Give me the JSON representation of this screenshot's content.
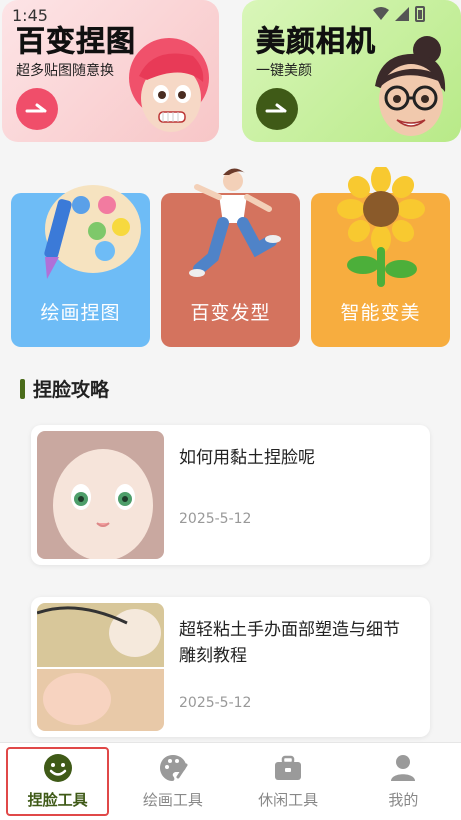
{
  "status_bar": {
    "time": "1:45"
  },
  "banners": [
    {
      "title": "百变捏图",
      "subtitle": "超多贴图随意换",
      "arrow_icon": "arrow-right-icon",
      "accent": "#f04e6a"
    },
    {
      "title": "美颜相机",
      "subtitle": "一键美颜",
      "arrow_icon": "arrow-right-icon",
      "accent": "#3f5a17"
    }
  ],
  "features": [
    {
      "label": "绘画捏图",
      "icon": "palette-icon",
      "color": "#6ebcf6"
    },
    {
      "label": "百变发型",
      "icon": "dancer-figure-icon",
      "color": "#d4735e"
    },
    {
      "label": "智能变美",
      "icon": "sunflower-icon",
      "color": "#f7ad3f"
    }
  ],
  "section": {
    "title": "捏脸攻略"
  },
  "articles": [
    {
      "title": "如何用黏土捏脸呢",
      "date": "2025-5-12"
    },
    {
      "title": "超轻粘土手办面部塑造与细节雕刻教程",
      "date": "2025-5-12"
    }
  ],
  "bottom_nav": [
    {
      "label": "捏脸工具",
      "icon": "smiley-icon",
      "active": true
    },
    {
      "label": "绘画工具",
      "icon": "palette-icon",
      "active": false
    },
    {
      "label": "休闲工具",
      "icon": "briefcase-icon",
      "active": false
    },
    {
      "label": "我的",
      "icon": "person-icon",
      "active": false
    }
  ],
  "colors": {
    "accent_green": "#3f5a17",
    "active_outline": "#e04848"
  }
}
